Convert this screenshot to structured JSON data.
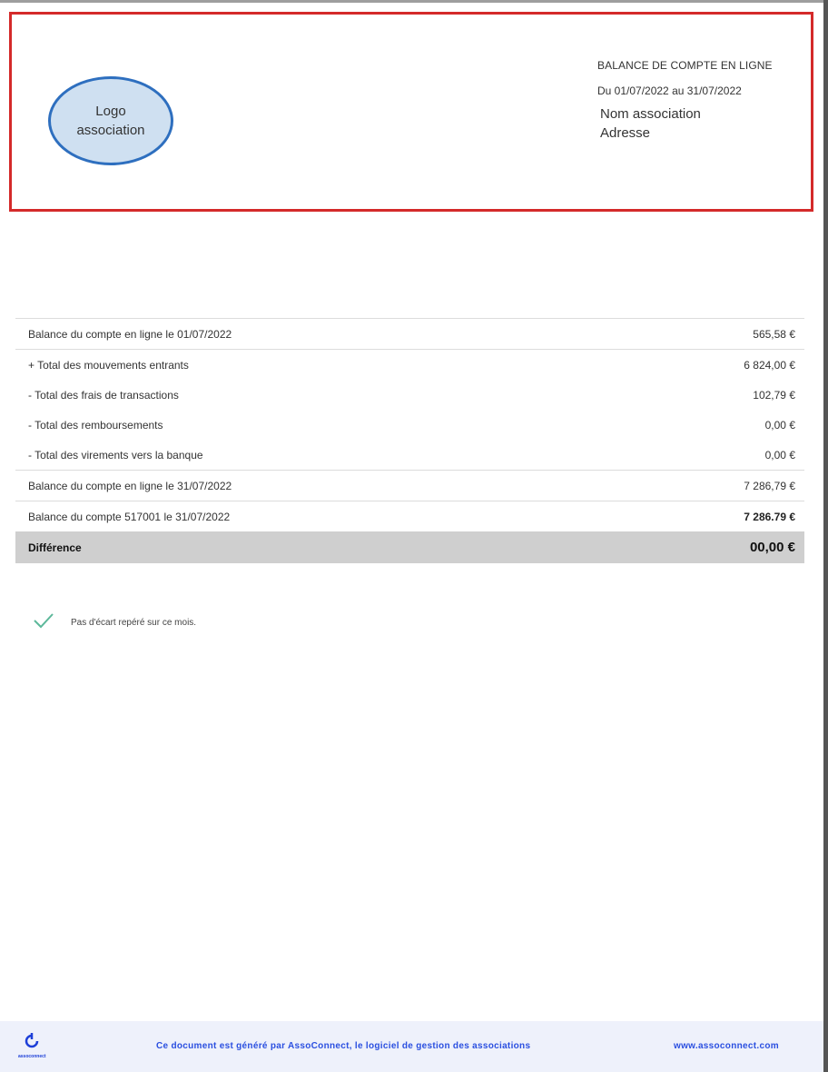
{
  "header": {
    "logo_text_line1": "Logo",
    "logo_text_line2": "association",
    "title": "BALANCE DE COMPTE EN LIGNE",
    "period": "Du 01/07/2022 au 31/07/2022",
    "association_name": "Nom association",
    "address": "Adresse"
  },
  "rows": [
    {
      "label": "Balance du compte en ligne le 01/07/2022",
      "amount": "565,58 €"
    },
    {
      "label": "+ Total des mouvements entrants",
      "amount": "6 824,00 €"
    },
    {
      "label": "- Total des frais de transactions",
      "amount": "102,79 €"
    },
    {
      "label": "- Total des remboursements",
      "amount": "0,00 €"
    },
    {
      "label": "- Total des virements vers la banque",
      "amount": "0,00 €"
    },
    {
      "label": "Balance du compte en ligne le 31/07/2022",
      "amount": "7 286,79 €"
    },
    {
      "label": "Balance du compte 517001 le 31/07/2022",
      "amount": "7 286.79 €"
    }
  ],
  "difference": {
    "label": "Différence",
    "amount": "00,00 €"
  },
  "status": {
    "icon": "check-icon",
    "message": "Pas d'écart repéré sur ce mois."
  },
  "footer": {
    "brand": "assoconnect",
    "generated_by": "Ce document est généré par AssoConnect, le logiciel de gestion des associations",
    "website": "www.assoconnect.com"
  },
  "colors": {
    "frame": "#d42a2a",
    "logo_border": "#2e6fbf",
    "logo_fill": "#cfe0f1",
    "footer_text": "#2a4fe0",
    "check": "#5cb89a"
  }
}
